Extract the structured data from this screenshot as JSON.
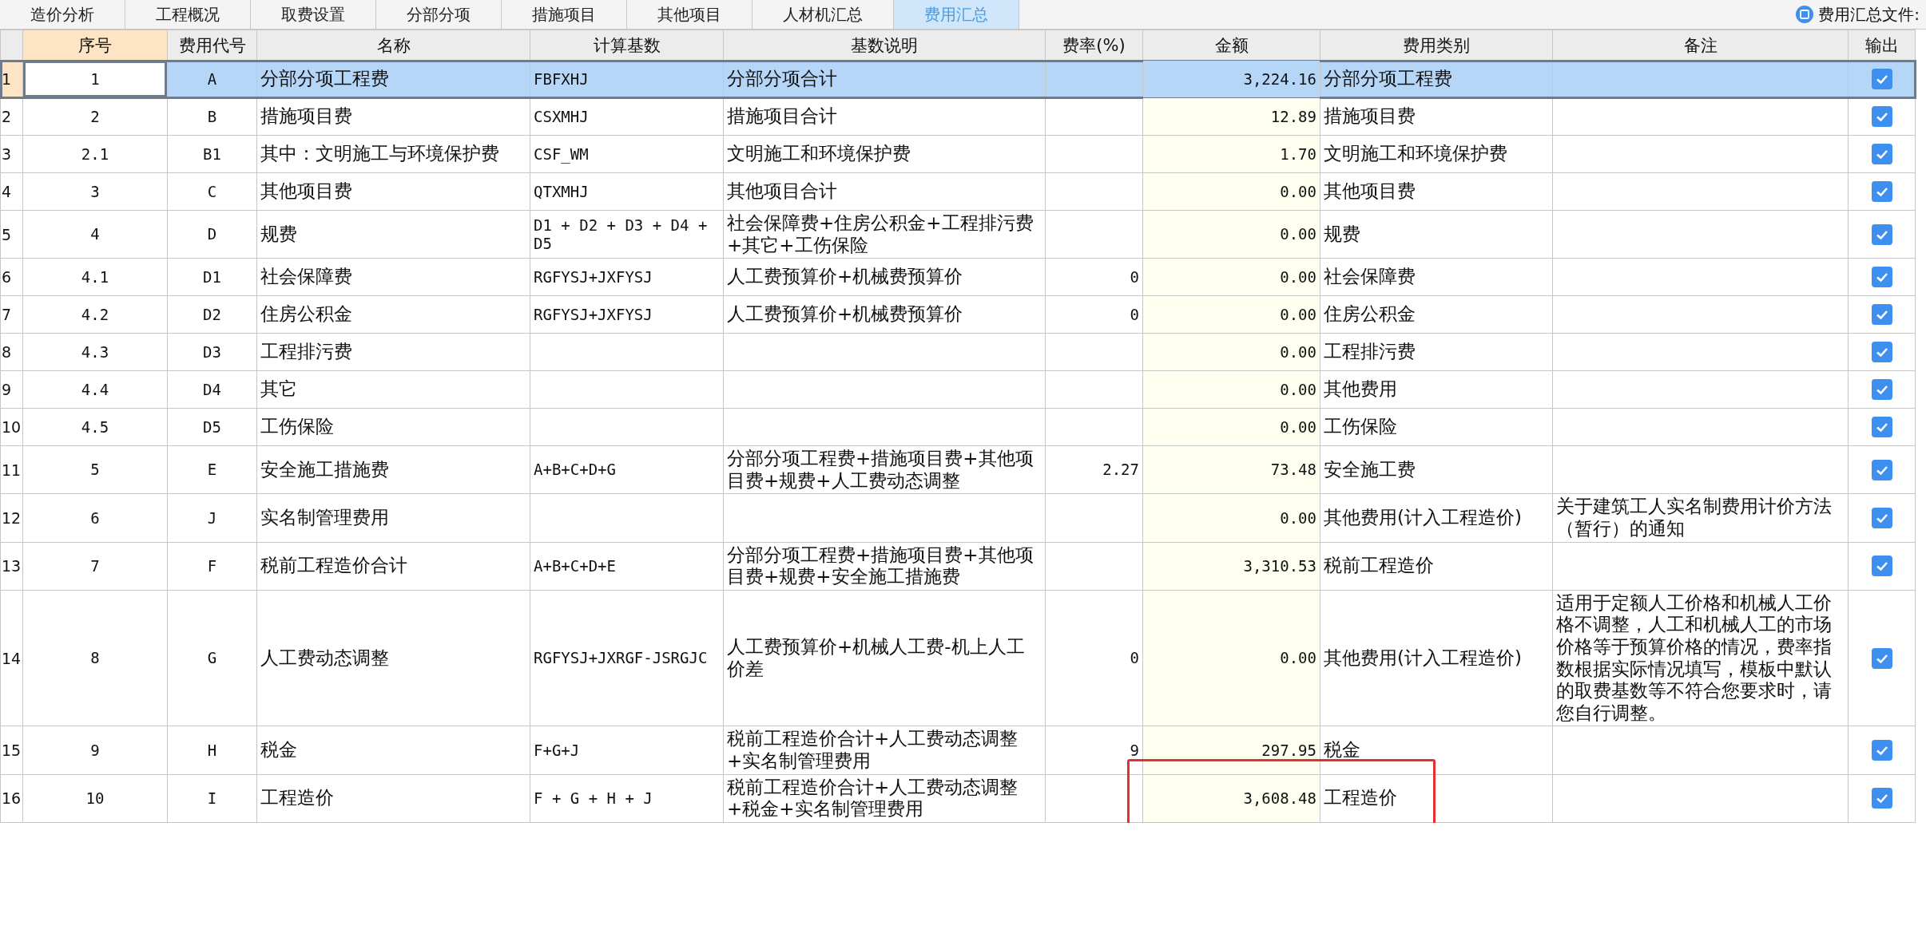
{
  "tabs": [
    {
      "label": "造价分析",
      "selected": false
    },
    {
      "label": "工程概况",
      "selected": false
    },
    {
      "label": "取费设置",
      "selected": false
    },
    {
      "label": "分部分项",
      "selected": false
    },
    {
      "label": "措施项目",
      "selected": false
    },
    {
      "label": "其他项目",
      "selected": false
    },
    {
      "label": "人材机汇总",
      "selected": false
    },
    {
      "label": "费用汇总",
      "selected": true
    }
  ],
  "file_note": "费用汇总文件:",
  "table": {
    "columns": [
      "序号",
      "费用代号",
      "名称",
      "计算基数",
      "基数说明",
      "费率(%)",
      "金额",
      "费用类别",
      "备注",
      "输出"
    ],
    "rows": [
      {
        "row_number": "1",
        "index": "1",
        "code": "A",
        "name": "分部分项工程费",
        "basis": "FBFXHJ",
        "basis_desc": "分部分项合计",
        "rate": "",
        "amount": "3,224.16",
        "category": "分部分项工程费",
        "remark": "",
        "output": true,
        "selected": true,
        "highlighted": false
      },
      {
        "row_number": "2",
        "index": "2",
        "code": "B",
        "name": "措施项目费",
        "basis": "CSXMHJ",
        "basis_desc": "措施项目合计",
        "rate": "",
        "amount": "12.89",
        "category": "措施项目费",
        "remark": "",
        "output": true,
        "selected": false,
        "highlighted": false
      },
      {
        "row_number": "3",
        "index": "2.1",
        "code": "B1",
        "name": "其中：文明施工与环境保护费",
        "basis": "CSF_WM",
        "basis_desc": "文明施工和环境保护费",
        "rate": "",
        "amount": "1.70",
        "category": "文明施工和环境保护费",
        "remark": "",
        "output": true,
        "selected": false,
        "highlighted": false
      },
      {
        "row_number": "4",
        "index": "3",
        "code": "C",
        "name": "其他项目费",
        "basis": "QTXMHJ",
        "basis_desc": "其他项目合计",
        "rate": "",
        "amount": "0.00",
        "category": "其他项目费",
        "remark": "",
        "output": true,
        "selected": false,
        "highlighted": false
      },
      {
        "row_number": "5",
        "index": "4",
        "code": "D",
        "name": "规费",
        "basis": "D1 + D2 + D3 + D4 + D5",
        "basis_desc": "社会保障费+住房公积金+工程排污费+其它+工伤保险",
        "rate": "",
        "amount": "0.00",
        "category": "规费",
        "remark": "",
        "output": true,
        "selected": false,
        "highlighted": false
      },
      {
        "row_number": "6",
        "index": "4.1",
        "code": "D1",
        "name": "社会保障费",
        "basis": "RGFYSJ+JXFYSJ",
        "basis_desc": "人工费预算价+机械费预算价",
        "rate": "0",
        "amount": "0.00",
        "category": "社会保障费",
        "remark": "",
        "output": true,
        "selected": false,
        "highlighted": false
      },
      {
        "row_number": "7",
        "index": "4.2",
        "code": "D2",
        "name": "住房公积金",
        "basis": "RGFYSJ+JXFYSJ",
        "basis_desc": "人工费预算价+机械费预算价",
        "rate": "0",
        "amount": "0.00",
        "category": "住房公积金",
        "remark": "",
        "output": true,
        "selected": false,
        "highlighted": false
      },
      {
        "row_number": "8",
        "index": "4.3",
        "code": "D3",
        "name": "工程排污费",
        "basis": "",
        "basis_desc": "",
        "rate": "",
        "amount": "0.00",
        "category": "工程排污费",
        "remark": "",
        "output": true,
        "selected": false,
        "highlighted": false
      },
      {
        "row_number": "9",
        "index": "4.4",
        "code": "D4",
        "name": "其它",
        "basis": "",
        "basis_desc": "",
        "rate": "",
        "amount": "0.00",
        "category": "其他费用",
        "remark": "",
        "output": true,
        "selected": false,
        "highlighted": false
      },
      {
        "row_number": "10",
        "index": "4.5",
        "code": "D5",
        "name": "工伤保险",
        "basis": "",
        "basis_desc": "",
        "rate": "",
        "amount": "0.00",
        "category": "工伤保险",
        "remark": "",
        "output": true,
        "selected": false,
        "highlighted": false
      },
      {
        "row_number": "11",
        "index": "5",
        "code": "E",
        "name": "安全施工措施费",
        "basis": "A+B+C+D+G",
        "basis_desc": "分部分项工程费+措施项目费+其他项目费+规费+人工费动态调整",
        "rate": "2.27",
        "amount": "73.48",
        "category": "安全施工费",
        "remark": "",
        "output": true,
        "selected": false,
        "highlighted": false
      },
      {
        "row_number": "12",
        "index": "6",
        "code": "J",
        "name": "实名制管理费用",
        "basis": "",
        "basis_desc": "",
        "rate": "",
        "amount": "0.00",
        "category": "其他费用(计入工程造价)",
        "remark": "关于建筑工人实名制费用计价方法（暂行）的通知",
        "output": true,
        "selected": false,
        "highlighted": false
      },
      {
        "row_number": "13",
        "index": "7",
        "code": "F",
        "name": "税前工程造价合计",
        "basis": "A+B+C+D+E",
        "basis_desc": "分部分项工程费+措施项目费+其他项目费+规费+安全施工措施费",
        "rate": "",
        "amount": "3,310.53",
        "category": "税前工程造价",
        "remark": "",
        "output": true,
        "selected": false,
        "highlighted": false
      },
      {
        "row_number": "14",
        "index": "8",
        "code": "G",
        "name": "人工费动态调整",
        "basis": "RGFYSJ+JXRGF-JSRGJC",
        "basis_desc": "人工费预算价+机械人工费-机上人工价差",
        "rate": "0",
        "amount": "0.00",
        "category": "其他费用(计入工程造价)",
        "remark": "适用于定额人工价格和机械人工价格不调整，人工和机械人工的市场价格等于预算价格的情况，费率指数根据实际情况填写，模板中默认的取费基数等不符合您要求时，请您自行调整。",
        "output": true,
        "selected": false,
        "highlighted": false
      },
      {
        "row_number": "15",
        "index": "9",
        "code": "H",
        "name": "税金",
        "basis": "F+G+J",
        "basis_desc": "税前工程造价合计+人工费动态调整+实名制管理费用",
        "rate": "9",
        "amount": "297.95",
        "category": "税金",
        "remark": "",
        "output": true,
        "selected": false,
        "highlighted": false
      },
      {
        "row_number": "16",
        "index": "10",
        "code": "I",
        "name": "工程造价",
        "basis": "F + G + H + J",
        "basis_desc": "税前工程造价合计+人工费动态调整+税金+实名制管理费用",
        "rate": "",
        "amount": "3,608.48",
        "category": "工程造价",
        "remark": "",
        "output": true,
        "selected": false,
        "highlighted": true
      }
    ]
  }
}
